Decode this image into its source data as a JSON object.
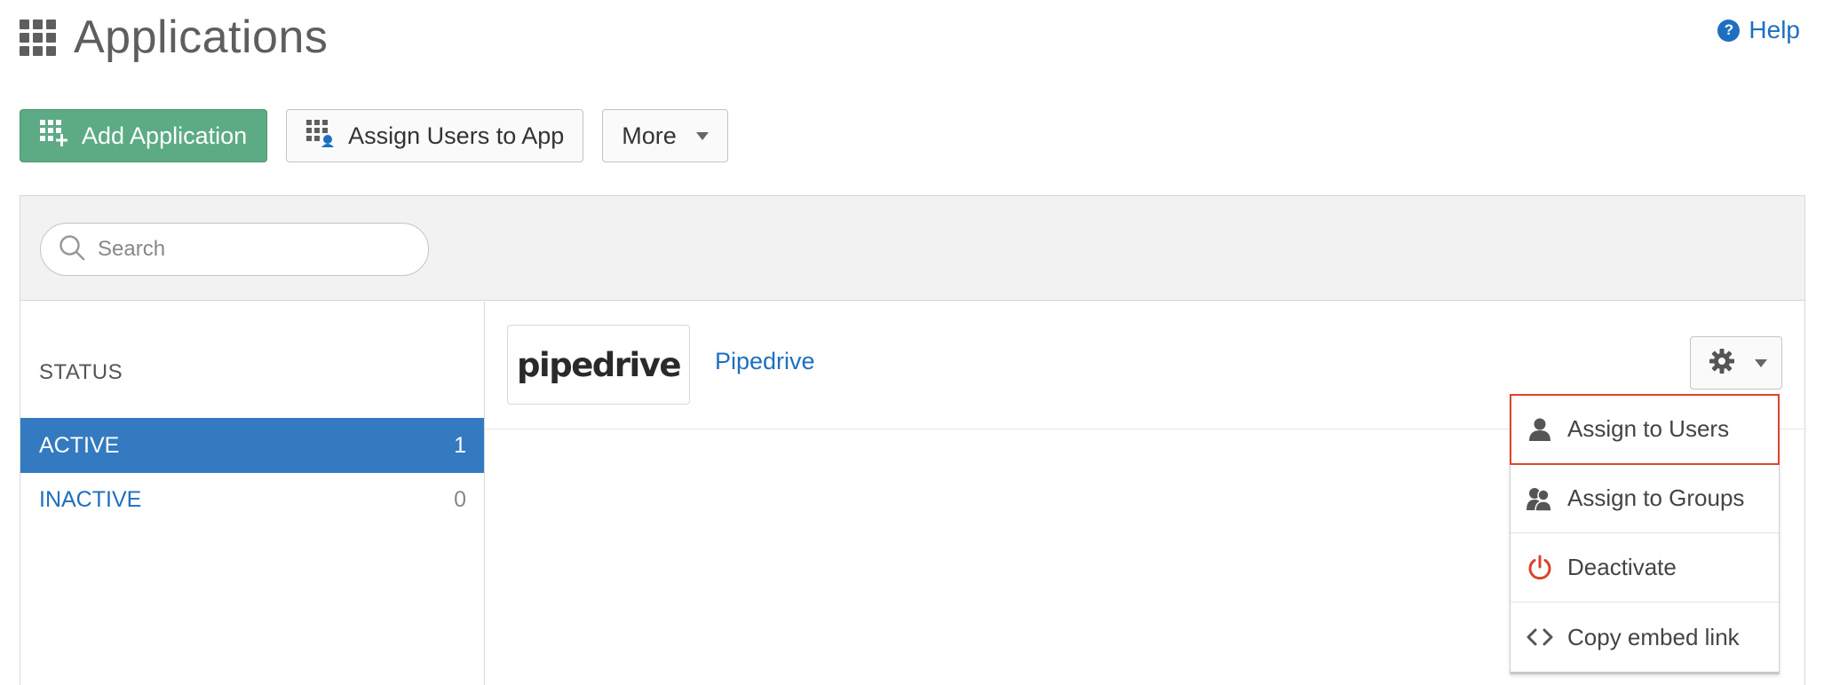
{
  "header": {
    "title": "Applications",
    "help_label": "Help"
  },
  "toolbar": {
    "add_application_label": "Add Application",
    "assign_users_label": "Assign Users to App",
    "more_label": "More"
  },
  "search": {
    "placeholder": "Search",
    "value": ""
  },
  "sidebar": {
    "status_heading": "STATUS",
    "items": [
      {
        "label": "ACTIVE",
        "count": "1",
        "selected": true
      },
      {
        "label": "INACTIVE",
        "count": "0",
        "selected": false
      }
    ]
  },
  "app_list": {
    "items": [
      {
        "logo_text": "pipedrive",
        "name": "Pipedrive"
      }
    ]
  },
  "app_menu": {
    "items": [
      {
        "label": "Assign to Users",
        "icon": "user-icon"
      },
      {
        "label": "Assign to Groups",
        "icon": "group-icon"
      },
      {
        "label": "Deactivate",
        "icon": "power-icon"
      },
      {
        "label": "Copy embed link",
        "icon": "code-icon"
      }
    ]
  },
  "colors": {
    "primary_button": "#5dab84",
    "link": "#1e6fbf",
    "active_row": "#337ac0",
    "deactivate_icon": "#d9432c",
    "highlight_outline": "#e0442d"
  }
}
